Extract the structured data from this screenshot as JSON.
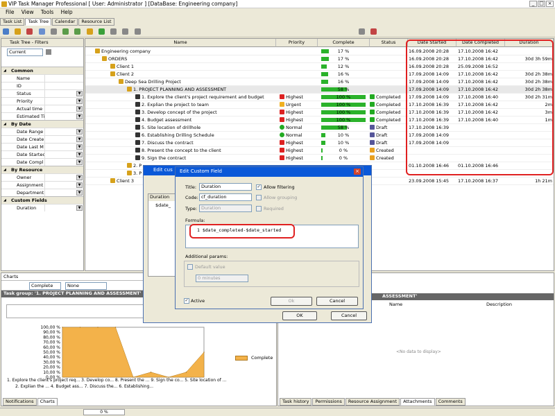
{
  "window": {
    "title": "VIP Task Manager Professional [ User: Administrator ] [DataBase: Engineering company]"
  },
  "menu": [
    "File",
    "View",
    "Tools",
    "Help"
  ],
  "tabs": [
    "Task List",
    "Task Tree",
    "Calendar",
    "Resource List"
  ],
  "filters": {
    "title": "Task Tree - Filters",
    "current": "Current",
    "sections": [
      {
        "title": "Common",
        "rows": [
          "Name",
          "ID",
          "Status",
          "Priority",
          "Actual time",
          "Estimated Ti"
        ]
      },
      {
        "title": "By Date",
        "rows": [
          "Date Range",
          "Date Create",
          "Date Last M",
          "Date Startec",
          "Date Compl"
        ]
      },
      {
        "title": "By Resource",
        "rows": [
          "Owner",
          "Assignment",
          "Department"
        ]
      },
      {
        "title": "Custom Fields",
        "rows": [
          "Duration"
        ]
      }
    ]
  },
  "grid": {
    "columns": [
      "Name",
      "Priority",
      "Complete",
      "Status",
      "Date Started",
      "Date Completed",
      "Duration"
    ],
    "rows": [
      {
        "name": "Engineering company",
        "priority": "",
        "complete": "17 %",
        "pct": 17,
        "status": "",
        "started": "16.09.2008 20:28",
        "completed": "17.10.2008 16:42",
        "duration": ""
      },
      {
        "name": "ORDERS",
        "priority": "",
        "complete": "17 %",
        "pct": 17,
        "status": "",
        "started": "16.09.2008 20:28",
        "completed": "17.10.2008 16:42",
        "duration": "30d 3h 59m"
      },
      {
        "name": "Client 1",
        "priority": "",
        "complete": "12 %",
        "pct": 12,
        "status": "",
        "started": "16.09.2008 20:28",
        "completed": "25.09.2008 16:52",
        "duration": ""
      },
      {
        "name": "Client 2",
        "priority": "",
        "complete": "16 %",
        "pct": 16,
        "status": "",
        "started": "17.09.2008 14:09",
        "completed": "17.10.2008 16:42",
        "duration": "30d 2h 38m"
      },
      {
        "name": "Deep Sea Drilling Project",
        "priority": "",
        "complete": "16 %",
        "pct": 16,
        "status": "",
        "started": "17.09.2008 14:09",
        "completed": "17.10.2008 16:42",
        "duration": "30d 2h 38m"
      },
      {
        "name": "1. PROJECT PLANNING AND ASSESSMENT",
        "priority": "",
        "complete": "58 %",
        "pct": 58,
        "status": "",
        "started": "17.09.2008 14:09",
        "completed": "17.10.2008 16:42",
        "duration": "30d 2h 38m"
      },
      {
        "name": "1. Explore the client's project requirement and budget",
        "priority": "Highest",
        "complete": "100 %",
        "pct": 100,
        "status": "Completed",
        "started": "17.09.2008 14:09",
        "completed": "17.10.2008 16:40",
        "duration": "30d 2h 31m"
      },
      {
        "name": "2. Explian the project to team",
        "priority": "Urgent",
        "complete": "100 %",
        "pct": 100,
        "status": "Completed",
        "started": "17.10.2008 16:39",
        "completed": "17.10.2008 16:42",
        "duration": "2m"
      },
      {
        "name": "3. Develop concept of the project",
        "priority": "Highest",
        "complete": "100 %",
        "pct": 100,
        "status": "Completed",
        "started": "17.10.2008 16:39",
        "completed": "17.10.2008 16:42",
        "duration": "3m"
      },
      {
        "name": "4. Budget assessment",
        "priority": "Highest",
        "complete": "100 %",
        "pct": 100,
        "status": "Completed",
        "started": "17.10.2008 16:39",
        "completed": "17.10.2008 16:40",
        "duration": "1m"
      },
      {
        "name": "5. Site location of drillhole",
        "priority": "Normal",
        "complete": "58 %",
        "pct": 58,
        "status": "Draft",
        "started": "17.10.2008 16:39",
        "completed": "",
        "duration": ""
      },
      {
        "name": "6. Establishing Drilling Schedule",
        "priority": "Normal",
        "complete": "10 %",
        "pct": 10,
        "status": "Draft",
        "started": "17.09.2008 14:09",
        "completed": "",
        "duration": ""
      },
      {
        "name": "7. Discuss the contract",
        "priority": "Highest",
        "complete": "10 %",
        "pct": 10,
        "status": "Draft",
        "started": "17.09.2008 14:09",
        "completed": "",
        "duration": ""
      },
      {
        "name": "8. Present the concept to the client",
        "priority": "Highest",
        "complete": "0 %",
        "pct": 0,
        "status": "Created",
        "started": "",
        "completed": "",
        "duration": ""
      },
      {
        "name": "9. Sign the contract",
        "priority": "Highest",
        "complete": "0 %",
        "pct": 0,
        "status": "Created",
        "started": "",
        "completed": "",
        "duration": ""
      },
      {
        "name": "2. P",
        "priority": "",
        "complete": "",
        "pct": 0,
        "status": "",
        "started": "01.10.2008 16:46",
        "completed": "01.10.2008 16:46",
        "duration": ""
      },
      {
        "name": "3. P",
        "priority": "",
        "complete": "",
        "pct": 0,
        "status": "",
        "started": "",
        "completed": "",
        "duration": ""
      },
      {
        "name": "Client 3",
        "priority": "",
        "complete": "",
        "pct": 0,
        "status": "",
        "started": "23.09.2008 15:45",
        "completed": "17.10.2008 16:37",
        "duration": "1h 21m"
      }
    ]
  },
  "charts": {
    "header": "Charts",
    "complete_select": "Complete",
    "none_select": "None",
    "task_group": "Task group: '1. PROJECT PLANNING AND ASSESSMENT'",
    "legend": "Complete",
    "xlabels_row1": "1. Explore the client's project req... 3. Develop co... 8. Present the ... 9. Sign the co... 5. Site location of ...",
    "xlabels_row2": "2. Explian the ... 4. Budget ass... 7. Discuss the... 6. Establishing..."
  },
  "chart_data": {
    "type": "area",
    "categories": [
      "1. Explore the client's project req...",
      "2. Explian the ...",
      "3. Develop co...",
      "4. Budget ass...",
      "8. Present the ...",
      "7. Discuss the...",
      "9. Sign the co...",
      "6. Establishing...",
      "5. Site location of ..."
    ],
    "series": [
      {
        "name": "Complete",
        "values": [
          100,
          100,
          100,
          100,
          0,
          10,
          0,
          10,
          50
        ]
      }
    ],
    "yticks": [
      "100,00 %",
      "90,00 %",
      "80,00 %",
      "70,00 %",
      "60,00 %",
      "50,00 %",
      "40,00 %",
      "30,00 %",
      "20,00 %",
      "10,00 %",
      "0,00 %"
    ],
    "ylim": [
      0,
      100
    ],
    "color": "#f3b24a"
  },
  "bottom_tabs_left": [
    "Notifications",
    "Charts"
  ],
  "bottom_tabs_right": [
    "Task history",
    "Permissions",
    "Resource Assignment",
    "Attachments",
    "Comments"
  ],
  "right_panel": {
    "header_suffix": "ASSESSMENT'",
    "col_name": "Name",
    "col_desc": "Description",
    "empty": "<No data to display>"
  },
  "status_progress": "0 %",
  "dialog_back": {
    "title": "Edit cus",
    "col": "Duration",
    "value": "$date_",
    "ok": "OK",
    "cancel": "Cancel"
  },
  "dialog": {
    "title": "Edit Custom Field",
    "title_label": "Title:",
    "title_value": "Duration",
    "code_label": "Code:",
    "code_value": "cf_duration",
    "type_label": "Type:",
    "type_value": "Duration",
    "allow_filtering": "Allow filtering",
    "allow_grouping": "Allow grouping",
    "required": "Required",
    "formula_label": "Formula:",
    "formula_value": "1 $date_completed-$date_started",
    "additional": "Additional params:",
    "default_value": "Default value",
    "default_select": "0 minutes",
    "active": "Active",
    "ok": "Ok",
    "cancel": "Cancel"
  },
  "colors": {
    "highlight": "#e02020",
    "progress": "#2bb22b",
    "chart": "#f3b24a",
    "titlebar": "#0a58d8"
  }
}
